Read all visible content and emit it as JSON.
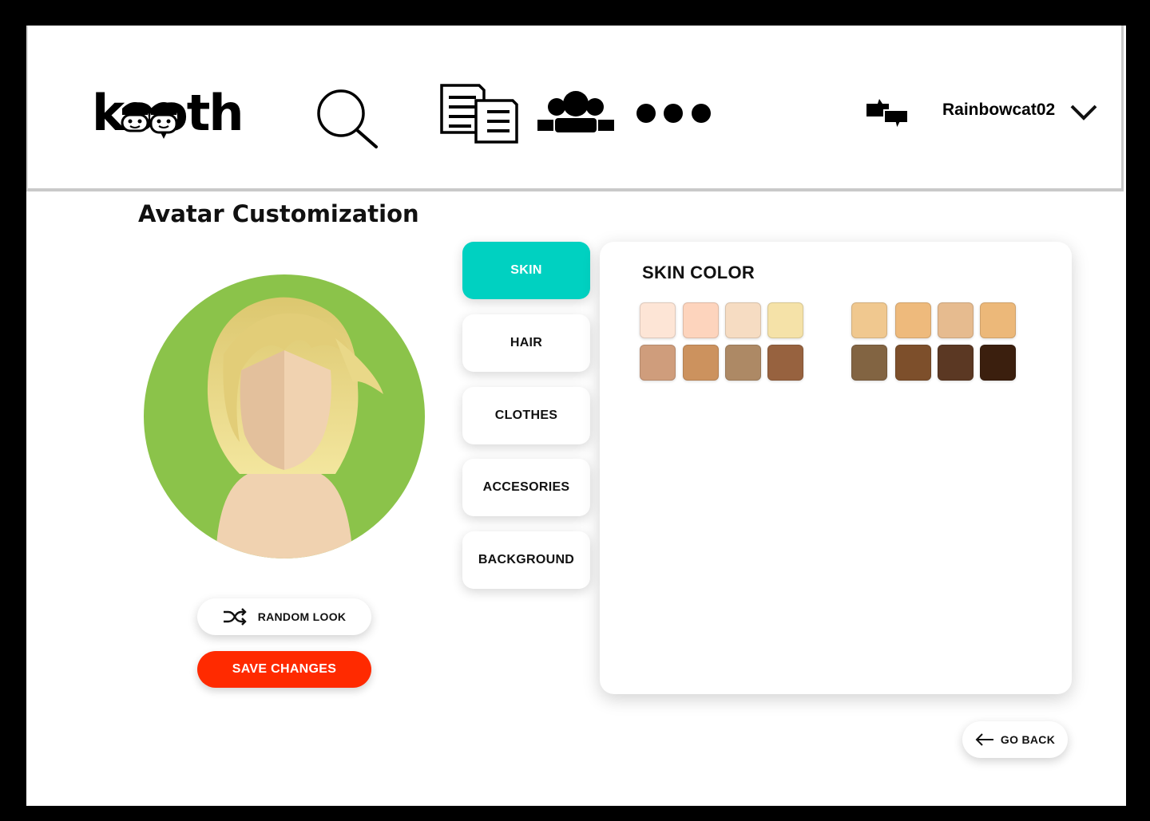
{
  "app": {
    "logo_text": "kooth",
    "username": "Rainbowcat02"
  },
  "nav": {
    "icons": [
      "search-icon",
      "articles-icon",
      "community-icon",
      "more-icon",
      "messages-icon",
      "chevron-down-icon"
    ]
  },
  "page": {
    "title": "Avatar Customization"
  },
  "avatar": {
    "background_color": "#8bc34a",
    "hair_color": "#e8d07a",
    "skin_color": "#f0d2b0"
  },
  "actions": {
    "random_label": "RANDOM LOOK",
    "save_label": "SAVE CHANGES",
    "back_label": "GO BACK"
  },
  "tabs": [
    {
      "label": "SKIN",
      "active": true
    },
    {
      "label": "HAIR",
      "active": false
    },
    {
      "label": "CLOTHES",
      "active": false
    },
    {
      "label": "ACCESORIES",
      "active": false
    },
    {
      "label": "BACKGROUND",
      "active": false
    }
  ],
  "panel": {
    "title": "SKIN COLOR",
    "swatches": [
      "#fde5d6",
      "#fdd4bd",
      "#f6dcc2",
      "#f5e2a8",
      "#f0c88f",
      "#eeba7c",
      "#e6bb8f",
      "#ecb879",
      "#cf9d7c",
      "#cc925e",
      "#ad8965",
      "#97623f",
      "#826442",
      "#7d4f2b",
      "#5b3823",
      "#3b1f0e"
    ]
  },
  "colors": {
    "accent": "#00d1c1",
    "save": "#ff2a00"
  }
}
